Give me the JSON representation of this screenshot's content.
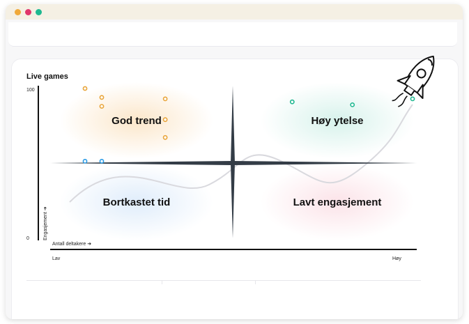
{
  "window": {
    "dots": [
      "#f0a93a",
      "#e0356b",
      "#1fb890"
    ]
  },
  "chart": {
    "title": "Live games"
  },
  "chart_data": {
    "type": "scatter",
    "title": "Live games",
    "xlabel": "Antall deltakere",
    "ylabel": "Engasjement",
    "x_tick_labels": [
      "Lav",
      "Høy"
    ],
    "y_tick_labels": [
      "0",
      "100"
    ],
    "ylim": [
      0,
      100
    ],
    "xlim": [
      0,
      100
    ],
    "quadrants": [
      {
        "label": "God trend",
        "color": "#f7c98a"
      },
      {
        "label": "Høy ytelse",
        "color": "#a7e3d4"
      },
      {
        "label": "Bortkastet tid",
        "color": "#b9d6f5"
      },
      {
        "label": "Lavt engasjement",
        "color": "#f7c0cc"
      }
    ],
    "series": [
      {
        "color": "#e9a53a",
        "points": [
          [
            5,
            100
          ],
          [
            10,
            94
          ],
          [
            10,
            88
          ],
          [
            29,
            93
          ],
          [
            29,
            79
          ],
          [
            29,
            67
          ]
        ]
      },
      {
        "color": "#1fb890",
        "points": [
          [
            67,
            91
          ],
          [
            85,
            89
          ],
          [
            103,
            93
          ]
        ]
      },
      {
        "color": "#2a9be6",
        "points": [
          [
            5,
            51
          ],
          [
            10,
            51
          ]
        ]
      }
    ],
    "grid": false
  }
}
